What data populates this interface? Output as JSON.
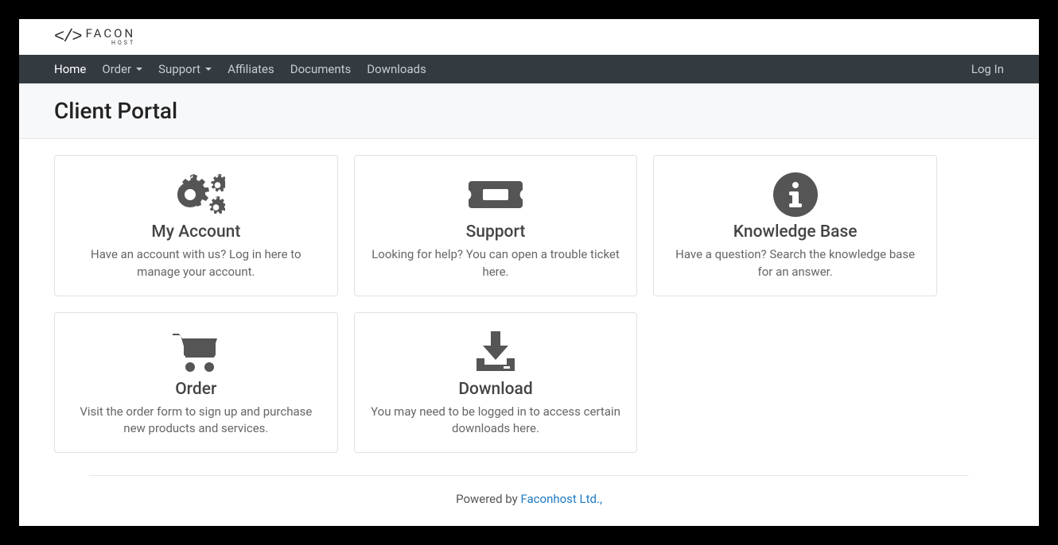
{
  "brand": {
    "name": "FACON",
    "sub": "HOST"
  },
  "nav": {
    "items": [
      {
        "label": "Home",
        "active": true,
        "dropdown": false
      },
      {
        "label": "Order",
        "active": false,
        "dropdown": true
      },
      {
        "label": "Support",
        "active": false,
        "dropdown": true
      },
      {
        "label": "Affiliates",
        "active": false,
        "dropdown": false
      },
      {
        "label": "Documents",
        "active": false,
        "dropdown": false
      },
      {
        "label": "Downloads",
        "active": false,
        "dropdown": false
      }
    ],
    "login": "Log In"
  },
  "page_title": "Client Portal",
  "cards": [
    {
      "icon": "gears-icon",
      "title": "My Account",
      "desc": "Have an account with us? Log in here to manage your account."
    },
    {
      "icon": "ticket-icon",
      "title": "Support",
      "desc": "Looking for help? You can open a trouble ticket here."
    },
    {
      "icon": "info-icon",
      "title": "Knowledge Base",
      "desc": "Have a question? Search the knowledge base for an answer."
    },
    {
      "icon": "cart-icon",
      "title": "Order",
      "desc": "Visit the order form to sign up and purchase new products and services."
    },
    {
      "icon": "download-icon",
      "title": "Download",
      "desc": "You may need to be logged in to access certain downloads here."
    }
  ],
  "footer": {
    "prefix": "Powered by ",
    "link": "Faconhost Ltd.,"
  }
}
